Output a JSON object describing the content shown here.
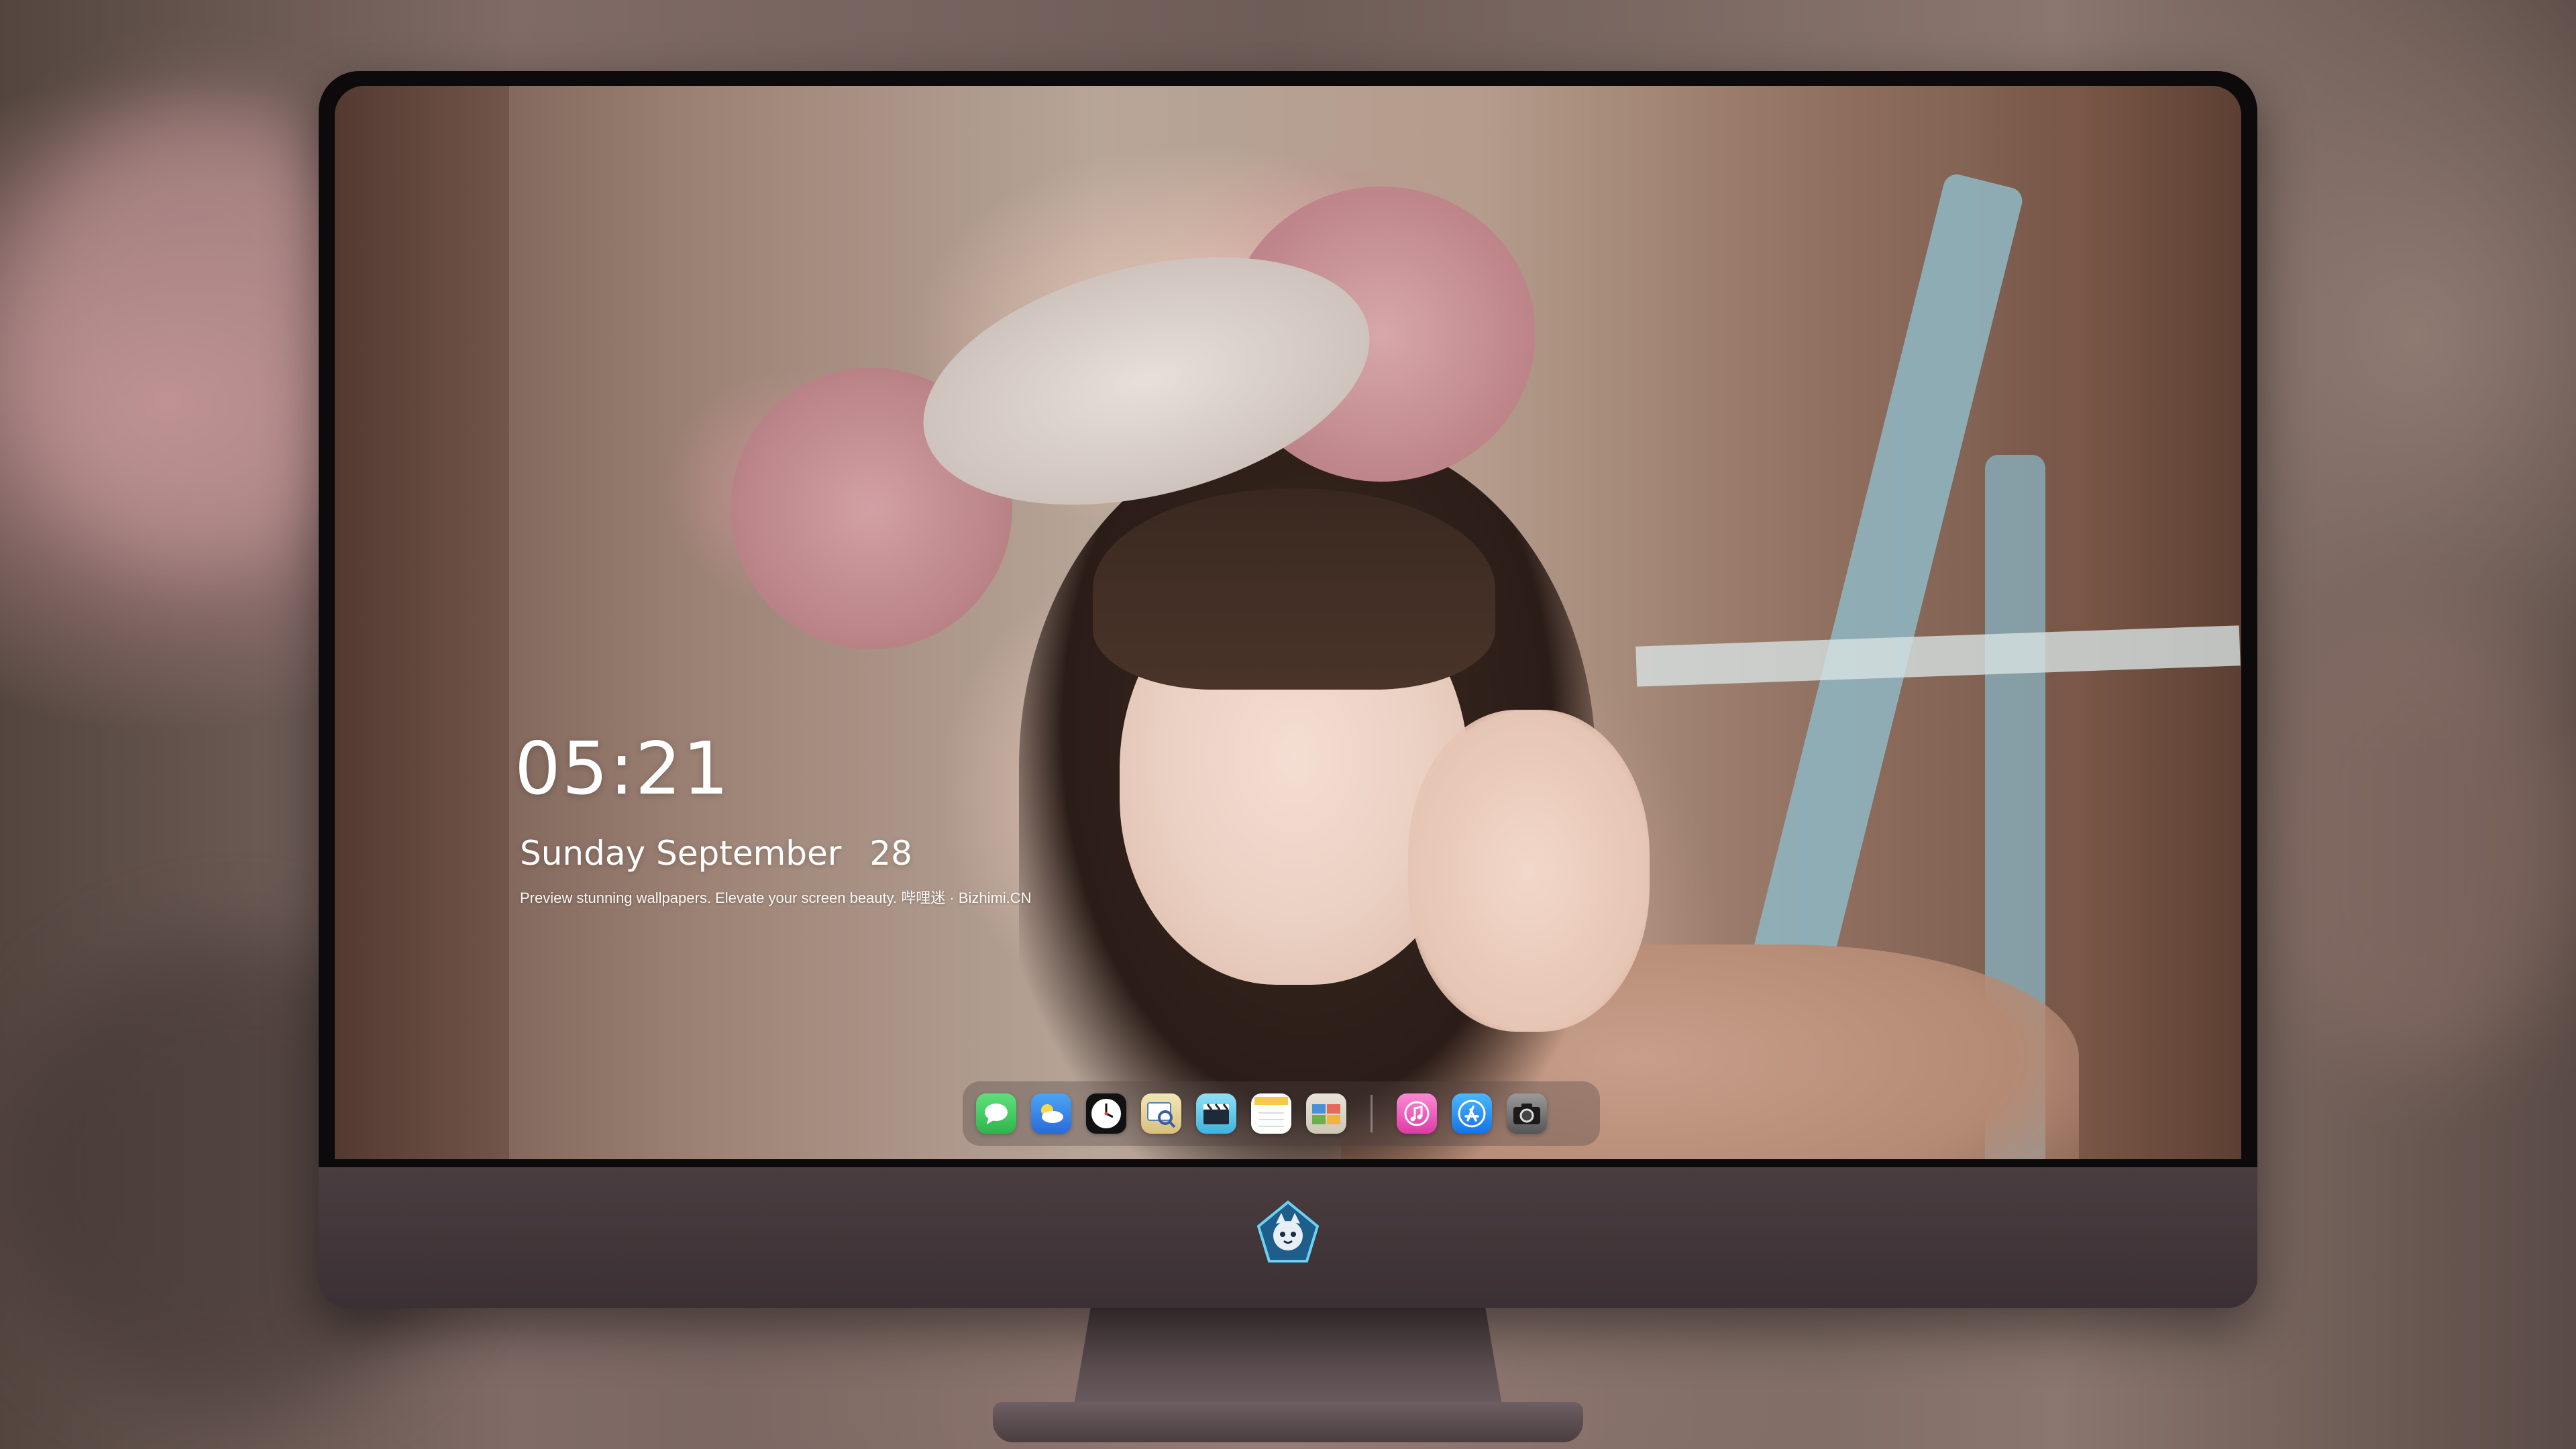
{
  "lock_screen": {
    "time": "05:21",
    "weekday": "Sunday",
    "month": "September",
    "day": "28",
    "tagline": "Preview stunning wallpapers. Elevate your screen beauty. 哔哩迷 · Bizhimi.CN"
  },
  "dock": {
    "apps": [
      {
        "name": "messages-icon",
        "color": "#34c759"
      },
      {
        "name": "weather-icon",
        "color": "#3a8ee6"
      },
      {
        "name": "clock-icon",
        "color": "#111111"
      },
      {
        "name": "preview-icon",
        "color": "#e9d7a0"
      },
      {
        "name": "clapper-icon",
        "color": "#5ac8e8"
      },
      {
        "name": "notes-icon",
        "color": "#ffffff"
      },
      {
        "name": "photo-slideshow-icon",
        "color": "#9bbf6a"
      }
    ],
    "pinned": [
      {
        "name": "music-icon",
        "color": "#f75ac0"
      },
      {
        "name": "app-store-icon",
        "color": "#1d9bf0"
      },
      {
        "name": "camera-icon",
        "color": "#5a5a5a"
      }
    ]
  },
  "colors": {
    "bezel": "#0c0a0b",
    "chin": "#4a3d40",
    "text": "#ffffff"
  }
}
